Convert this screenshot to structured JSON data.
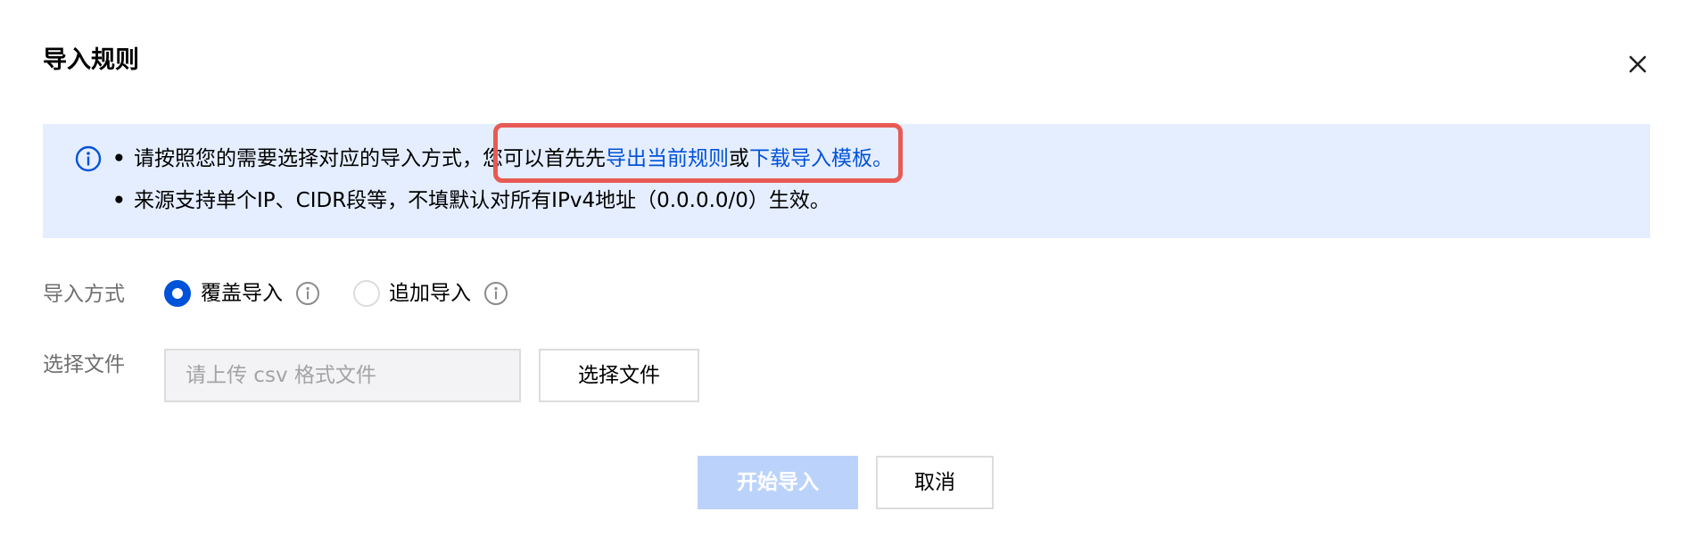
{
  "dialog": {
    "title": "导入规则",
    "close_icon": "close-icon"
  },
  "notice": {
    "icon": "info-circle-icon",
    "line1_prefix": "请按照您的需要选择对应的导入方式，",
    "line1_middle": "您可以首先先",
    "link_export": "导出当前规则",
    "line1_or": "或",
    "link_template": "下载导入模板",
    "line1_suffix": "。",
    "line2": "来源支持单个IP、CIDR段等，不填默认对所有IPv4地址（0.0.0.0/0）生效。",
    "highlight_color": "#e85a55"
  },
  "form": {
    "mode_label": "导入方式",
    "mode_options": [
      {
        "label": "覆盖导入",
        "selected": true
      },
      {
        "label": "追加导入",
        "selected": false
      }
    ],
    "file_label": "选择文件",
    "file_placeholder": "请上传 csv 格式文件",
    "file_button": "选择文件"
  },
  "footer": {
    "start_button": "开始导入",
    "start_disabled": true,
    "cancel_button": "取消"
  },
  "colors": {
    "primary": "#0052d9",
    "notice_bg": "#e5eeff",
    "disabled_primary": "#bbd3fb",
    "label_gray": "#6f6f6f"
  }
}
